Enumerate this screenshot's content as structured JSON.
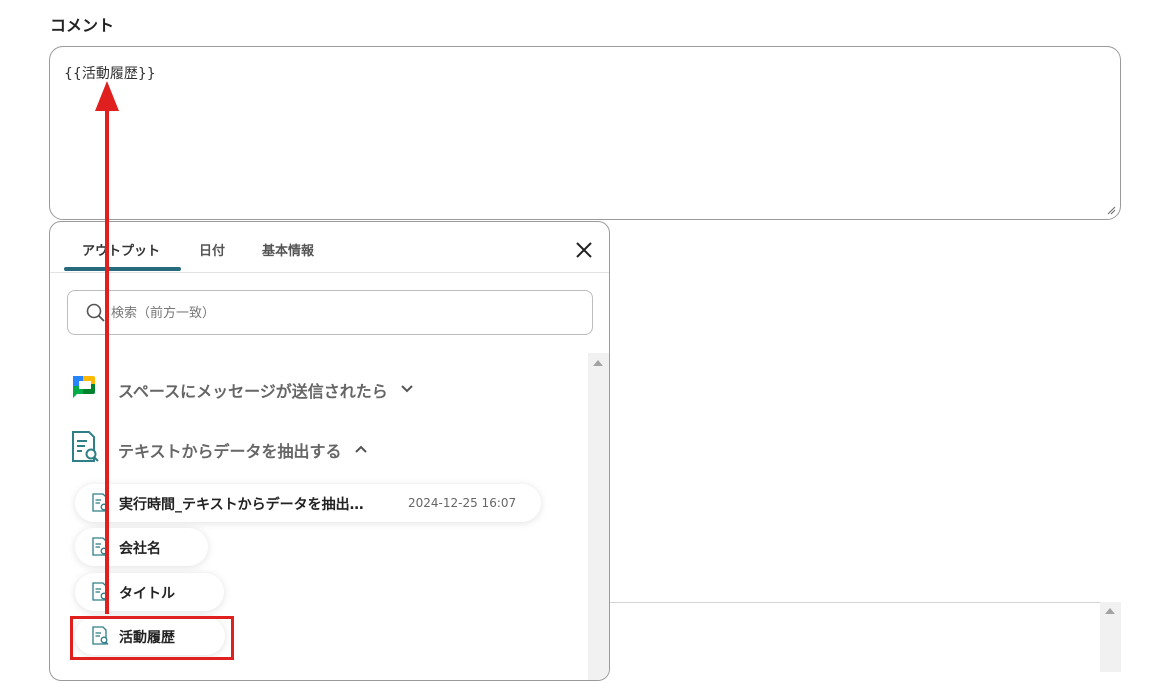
{
  "comment": {
    "label": "コメント",
    "value": "{{活動履歴}}"
  },
  "popup": {
    "tabs": [
      {
        "label": "アウトプット",
        "active": true
      },
      {
        "label": "日付",
        "active": false
      },
      {
        "label": "基本情報",
        "active": false
      }
    ],
    "search": {
      "placeholder": "検索（前方一致）",
      "value": ""
    },
    "sections": [
      {
        "title": "スペースにメッセージが送信されたら",
        "icon": "google-chat-icon",
        "expanded": false
      },
      {
        "title": "テキストからデータを抽出する",
        "icon": "document-search-icon",
        "expanded": true
      }
    ],
    "items": [
      {
        "label": "実行時間_テキストからデータを抽出…",
        "time": "2024-12-25 16:07"
      },
      {
        "label": "会社名"
      },
      {
        "label": "タイトル"
      },
      {
        "label": "活動履歴",
        "highlighted": true
      }
    ]
  },
  "colors": {
    "accent": "#27697d",
    "annotation": "#e0201f"
  }
}
